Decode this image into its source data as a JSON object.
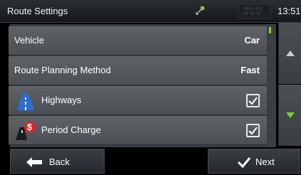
{
  "header": {
    "title": "Route Settings",
    "speed_line1": "REG. 473",
    "speed_line2": "AF 16 TF",
    "clock": "13:51"
  },
  "settings": {
    "rows": [
      {
        "label": "Vehicle",
        "value": "Car"
      },
      {
        "label": "Route Planning Method",
        "value": "Fast"
      },
      {
        "label": "Highways",
        "checked": true,
        "icon": "highway-icon"
      },
      {
        "label": "Period Charge",
        "checked": true,
        "icon": "period-charge-icon"
      }
    ]
  },
  "footer": {
    "back_label": "Back",
    "next_label": "Next"
  },
  "colors": {
    "accent": "#7fd22a",
    "row_bg": "#55595e",
    "panel_bg": "#3b3f44"
  }
}
